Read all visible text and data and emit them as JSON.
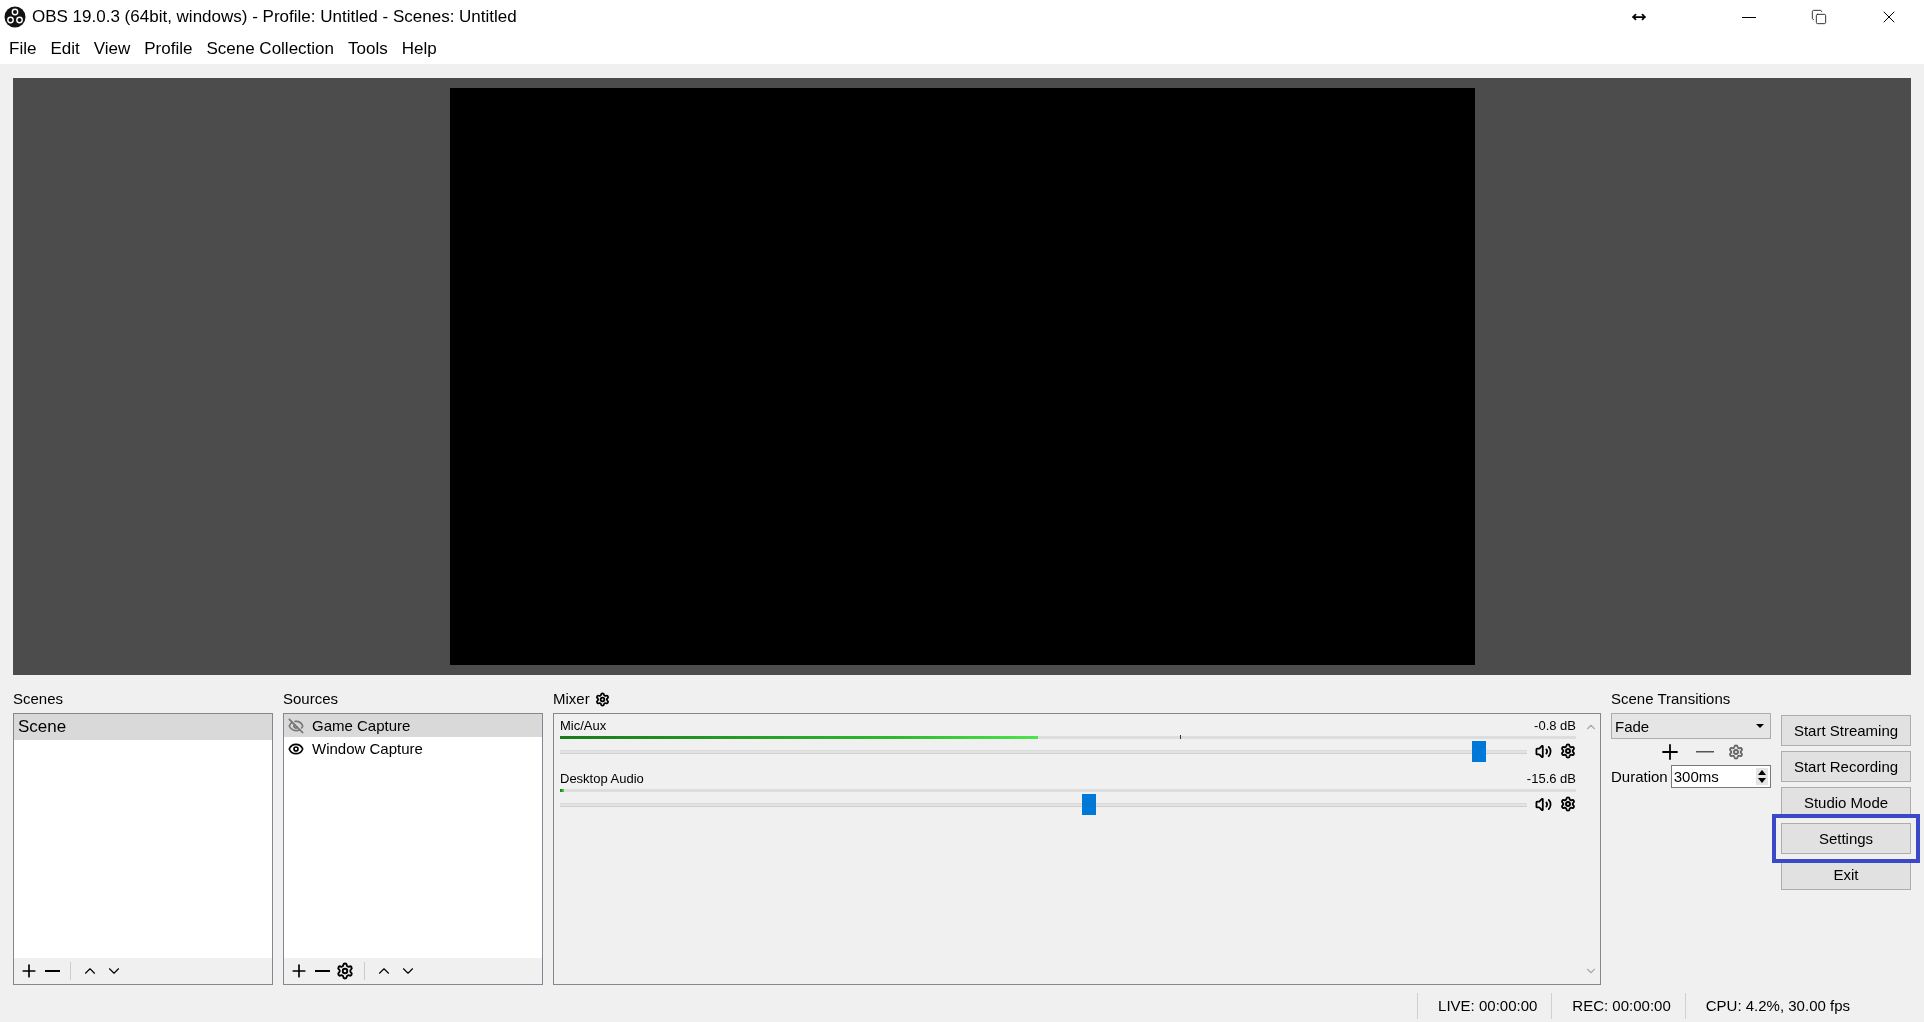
{
  "window": {
    "title": "OBS 19.0.3 (64bit, windows) - Profile: Untitled - Scenes: Untitled"
  },
  "menu": [
    "File",
    "Edit",
    "View",
    "Profile",
    "Scene Collection",
    "Tools",
    "Help"
  ],
  "scenes": {
    "title": "Scenes",
    "items": [
      {
        "name": "Scene",
        "selected": true
      }
    ]
  },
  "sources": {
    "title": "Sources",
    "items": [
      {
        "name": "Game Capture",
        "selected": true,
        "visible": false
      },
      {
        "name": "Window Capture",
        "selected": false,
        "visible": true
      }
    ]
  },
  "mixer": {
    "title": "Mixer",
    "channels": [
      {
        "name": "Mic/Aux",
        "reading": "-0.8 dB",
        "meter": {
          "level": 0.47
        },
        "peak": {
          "level": 0.61
        },
        "fader": {
          "level": 0.95
        }
      },
      {
        "name": "Desktop Audio",
        "reading": "-15.6 dB",
        "meter": {
          "level": 0.004
        },
        "fader": {
          "level": 0.547
        }
      }
    ]
  },
  "transitions": {
    "title": "Scene Transitions",
    "transition": "Fade",
    "duration_label": "Duration",
    "duration": "300ms"
  },
  "controls": [
    {
      "label": "Start Streaming",
      "highlighted": false
    },
    {
      "label": "Start Recording",
      "highlighted": false
    },
    {
      "label": "Studio Mode",
      "highlighted": false
    },
    {
      "label": "Settings",
      "highlighted": true
    },
    {
      "label": "Exit",
      "highlighted": false
    }
  ],
  "status": [
    "LIVE: 00:00:00",
    "REC: 00:00:00",
    "CPU: 4.2%, 30.00 fps"
  ]
}
